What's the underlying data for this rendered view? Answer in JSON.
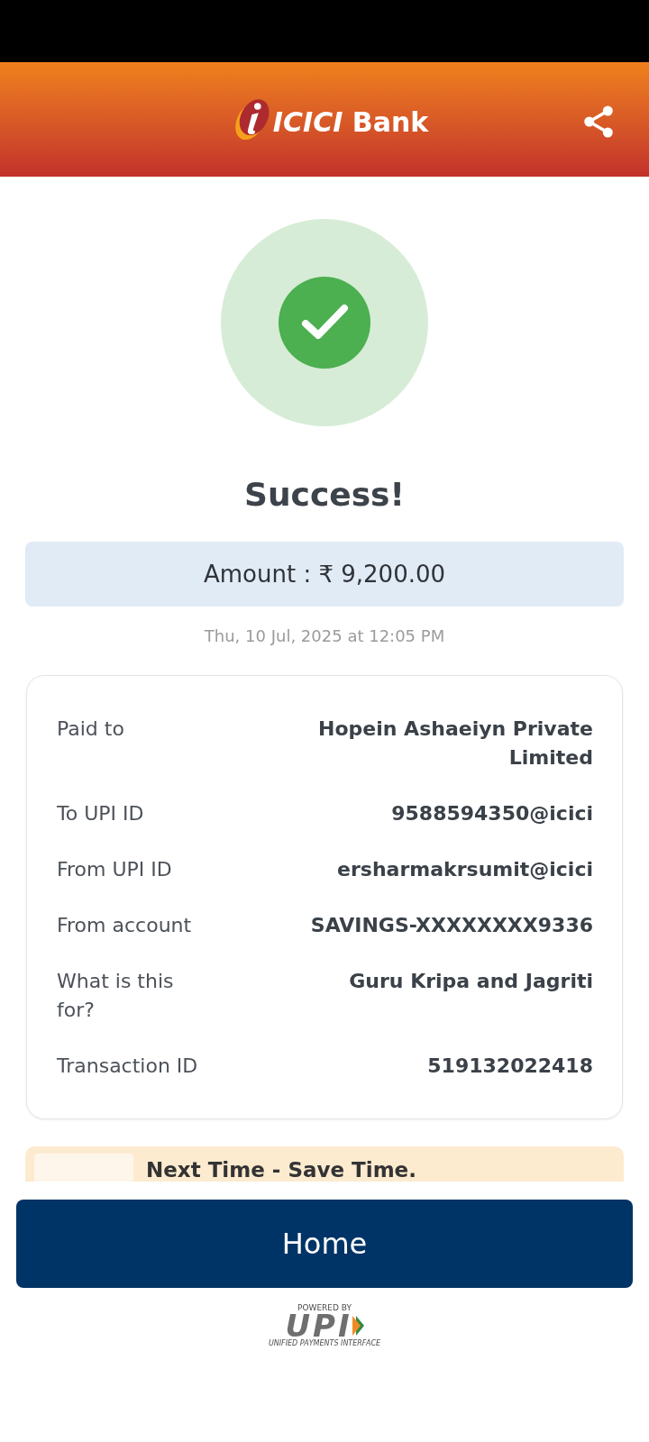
{
  "header": {
    "logo_text": "*ICICI* Bank"
  },
  "result": {
    "title": "Success!",
    "amount": "Amount : ₹ 9,200.00",
    "timestamp": "Thu, 10 Jul, 2025 at 12:05 PM"
  },
  "details": [
    {
      "label": "Paid to",
      "value": "Hopein Ashaeiyn Private Limited"
    },
    {
      "label": "To UPI ID",
      "value": "9588594350@icici"
    },
    {
      "label": "From UPI ID",
      "value": "ersharmakrsumit@icici"
    },
    {
      "label": "From account",
      "value": "SAVINGS-XXXXXXXX9336"
    },
    {
      "label": "What is this for?",
      "value": "Guru Kripa and Jagriti"
    },
    {
      "label": "Transaction ID",
      "value": "519132022418"
    }
  ],
  "promo": {
    "title": "Next Time - Save Time."
  },
  "home_button": {
    "label": "Home"
  },
  "footer": {
    "powered_by": "POWERED BY",
    "logo": "UPI",
    "tagline": "UNIFIED PAYMENTS INTERFACE"
  }
}
